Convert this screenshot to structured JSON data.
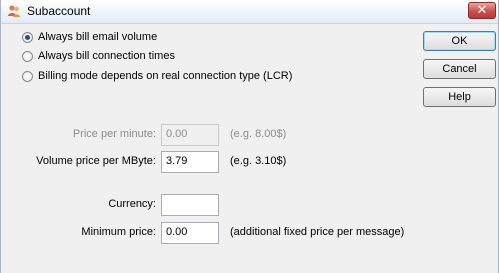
{
  "window": {
    "title": "Subaccount",
    "close_glyph": "✕",
    "icon": "people-icon"
  },
  "billing_modes": [
    {
      "label": "Always bill email volume",
      "checked": true
    },
    {
      "label": "Always bill connection times",
      "checked": false
    },
    {
      "label": "Billing mode depends on real connection type (LCR)",
      "checked": false
    }
  ],
  "buttons": {
    "ok": "OK",
    "cancel": "Cancel",
    "help": "Help"
  },
  "price_per_minute": {
    "label": "Price per minute:",
    "value": "0.00",
    "hint": "(e.g. 8.00$)",
    "enabled": false
  },
  "volume_price": {
    "label": "Volume price per MByte:",
    "value": "3.79",
    "hint": "(e.g. 3.10$)"
  },
  "currency": {
    "label": "Currency:",
    "value": ""
  },
  "minimum_price": {
    "label": "Minimum price:",
    "value": "0.00",
    "hint": "(additional fixed price per message)"
  }
}
